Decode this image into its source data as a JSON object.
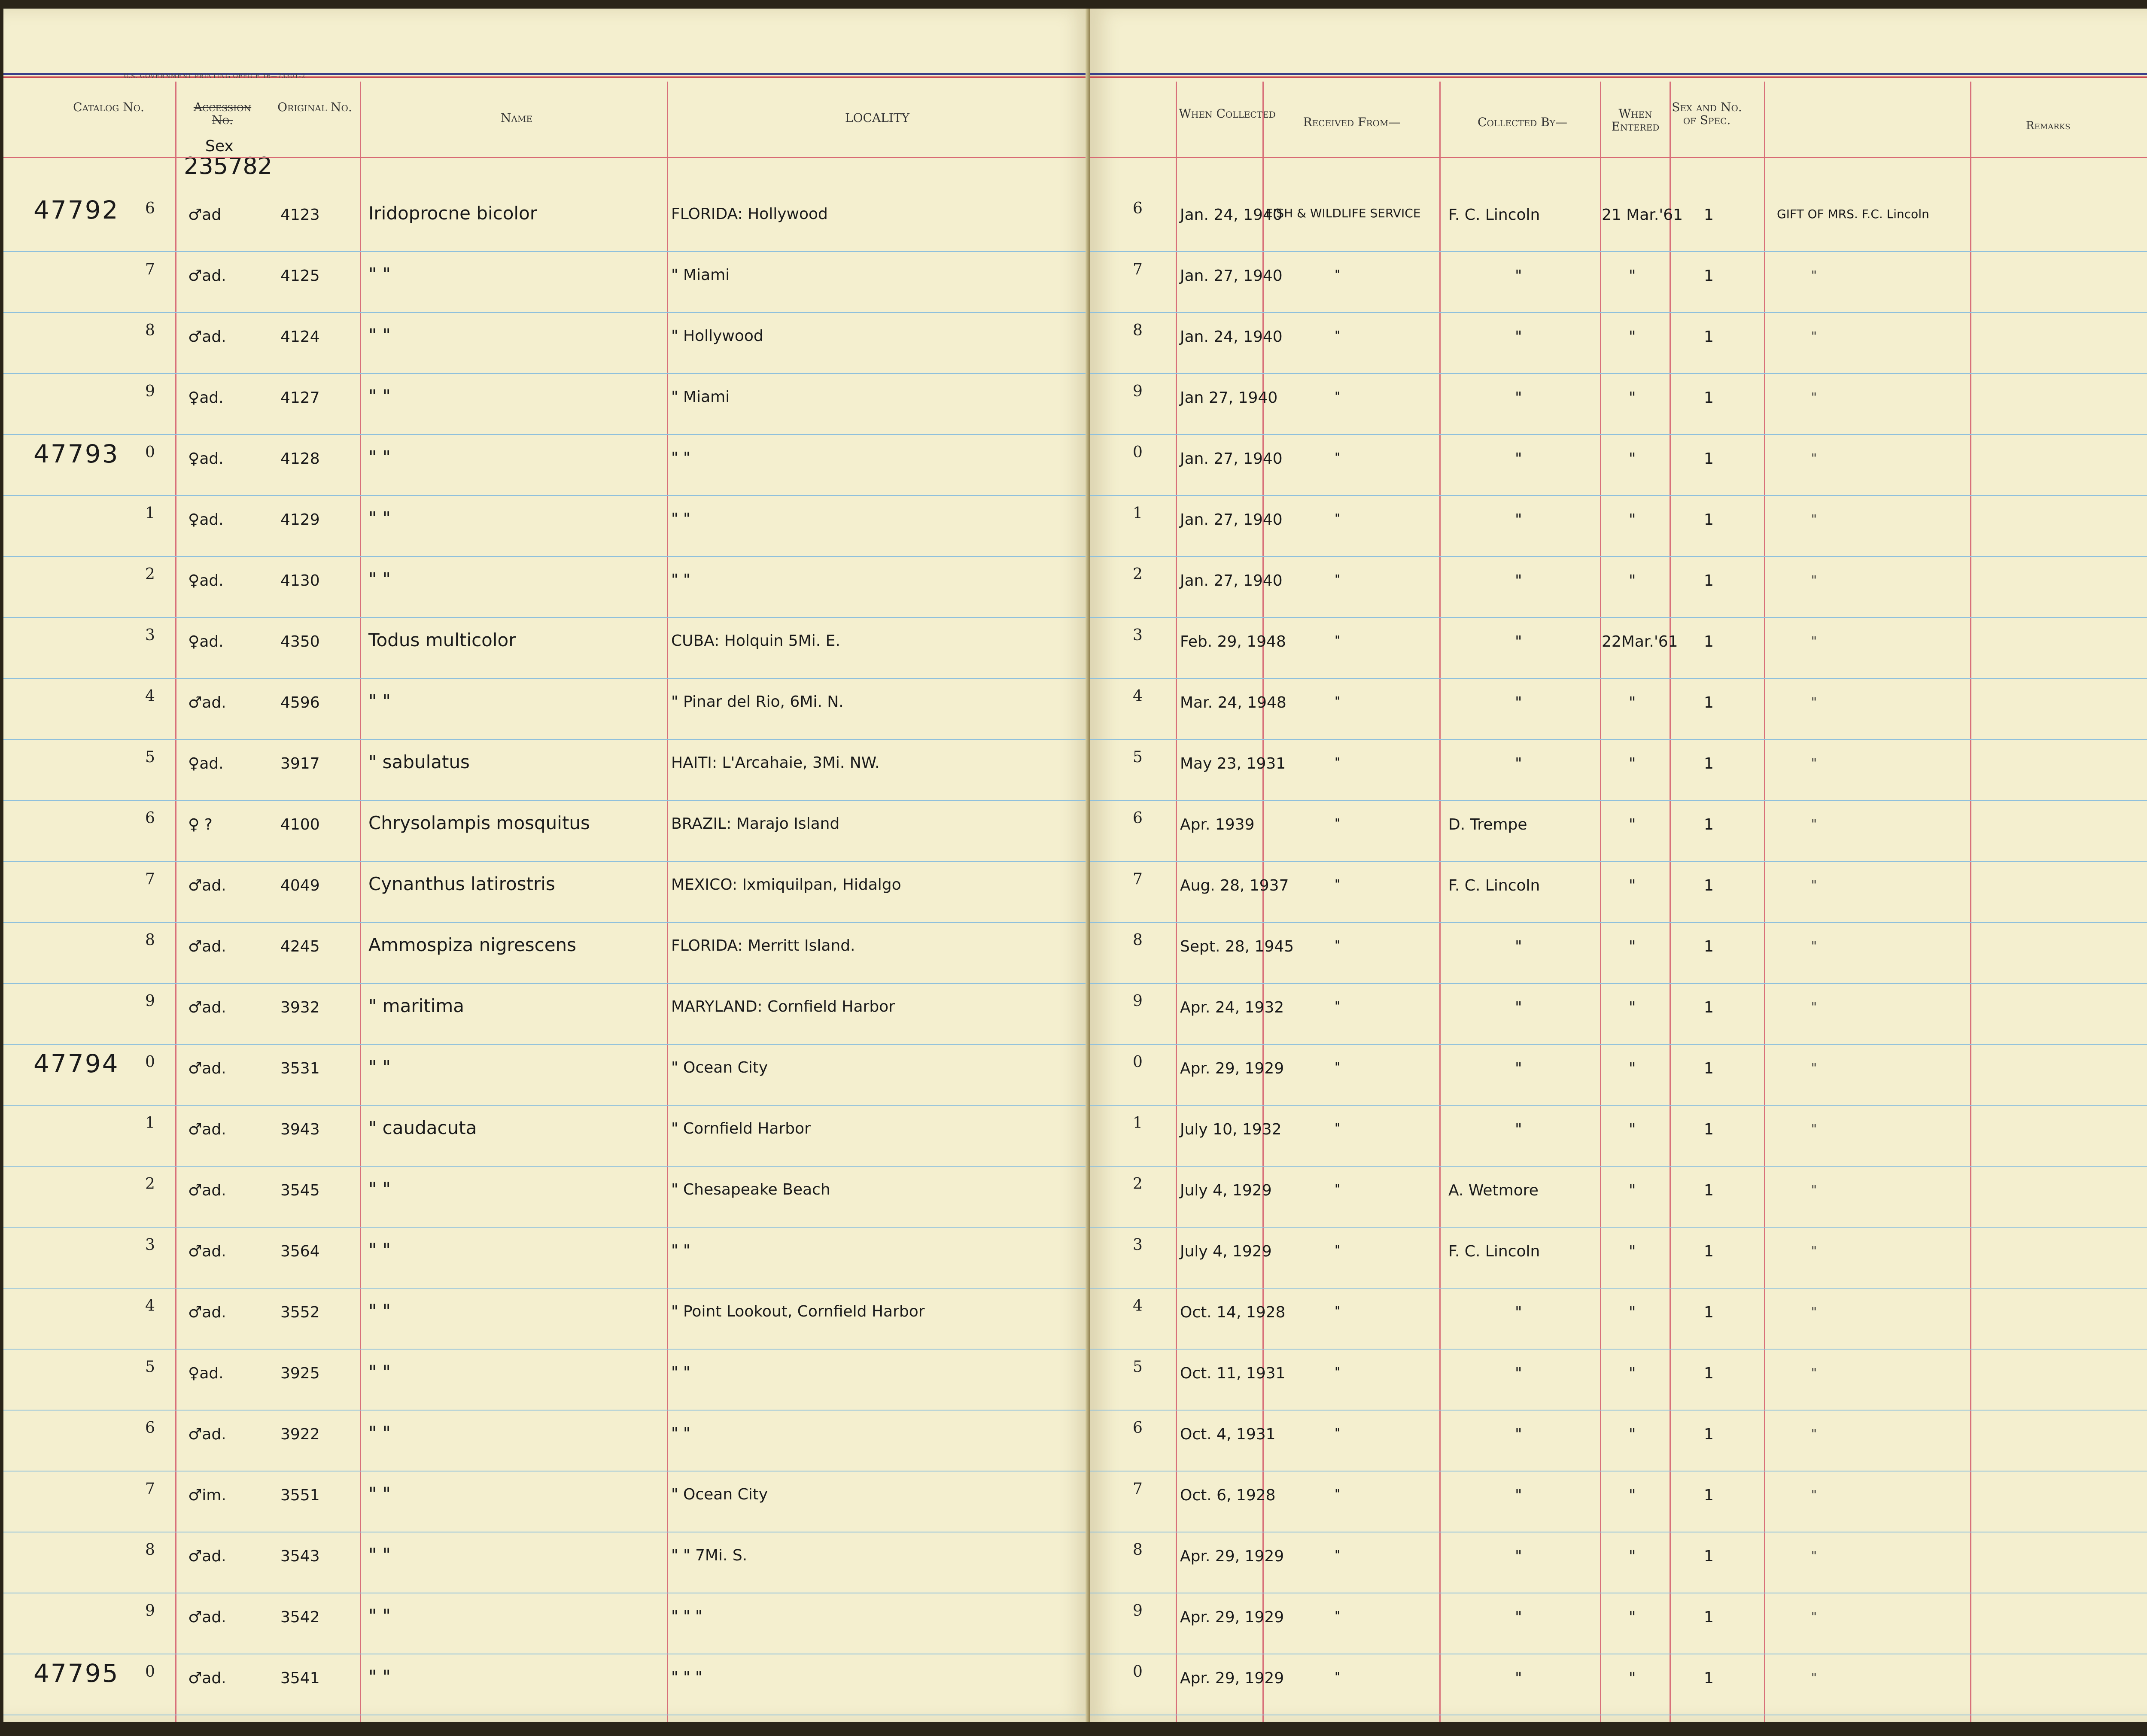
{
  "header_print": {
    "gpo": "U.S. GOVERNMENT PRINTING OFFICE     16—73301-2"
  },
  "columns_left": {
    "catalog": "Catalog No.",
    "accession": "Accession No.",
    "sex_handwritten": "Sex",
    "original": "Original No.",
    "name": "Name",
    "locality": "LOCALITY"
  },
  "columns_right": {
    "when_collected": "When Collected",
    "received_from": "Received From—",
    "collected_by": "Collected By—",
    "when_entered": "When Entered",
    "sex_no_spec": "Sex and No. of Spec.",
    "remarks": "Remarks"
  },
  "accession_number": "235782",
  "rows": [
    {
      "cat": "47792",
      "d": "6",
      "sex": "♂ad",
      "orig": "4123",
      "name": "Iridoprocne bicolor",
      "loc": "FLORIDA: Hollywood",
      "date": "Jan. 24, 1940",
      "recv": "FISH & WILDLIFE SERVICE",
      "coll": "F. C. Lincoln",
      "ent": "21 Mar.'61",
      "spec": "1",
      "rem": "GIFT OF MRS. F.C. Lincoln"
    },
    {
      "cat": "",
      "d": "7",
      "sex": "♂ad.",
      "orig": "4125",
      "name": "\"     \"",
      "loc": "\"     Miami",
      "date": "Jan. 27, 1940",
      "recv": "\"",
      "coll": "\"",
      "ent": "\"",
      "spec": "1",
      "rem": "\""
    },
    {
      "cat": "",
      "d": "8",
      "sex": "♂ad.",
      "orig": "4124",
      "name": "\"     \"",
      "loc": "\"     Hollywood",
      "date": "Jan. 24, 1940",
      "recv": "\"",
      "coll": "\"",
      "ent": "\"",
      "spec": "1",
      "rem": "\""
    },
    {
      "cat": "",
      "d": "9",
      "sex": "♀ad.",
      "orig": "4127",
      "name": "\"     \"",
      "loc": "\"     Miami",
      "date": "Jan 27, 1940",
      "recv": "\"",
      "coll": "\"",
      "ent": "\"",
      "spec": "1",
      "rem": "\""
    },
    {
      "cat": "47793",
      "d": "0",
      "sex": "♀ad.",
      "orig": "4128",
      "name": "\"     \"",
      "loc": "\"     \"",
      "date": "Jan. 27, 1940",
      "recv": "\"",
      "coll": "\"",
      "ent": "\"",
      "spec": "1",
      "rem": "\""
    },
    {
      "cat": "",
      "d": "1",
      "sex": "♀ad.",
      "orig": "4129",
      "name": "\"     \"",
      "loc": "\"     \"",
      "date": "Jan. 27, 1940",
      "recv": "\"",
      "coll": "\"",
      "ent": "\"",
      "spec": "1",
      "rem": "\""
    },
    {
      "cat": "",
      "d": "2",
      "sex": "♀ad.",
      "orig": "4130",
      "name": "\"     \"",
      "loc": "\"     \"",
      "date": "Jan. 27, 1940",
      "recv": "\"",
      "coll": "\"",
      "ent": "\"",
      "spec": "1",
      "rem": "\""
    },
    {
      "cat": "",
      "d": "3",
      "sex": "♀ad.",
      "orig": "4350",
      "name": "Todus multicolor",
      "loc": "CUBA: Holquin 5Mi. E.",
      "date": "Feb. 29, 1948",
      "recv": "\"",
      "coll": "\"",
      "ent": "22Mar.'61",
      "spec": "1",
      "rem": "\""
    },
    {
      "cat": "",
      "d": "4",
      "sex": "♂ad.",
      "orig": "4596",
      "name": "\"     \"",
      "loc": "\"     Pinar del Rio, 6Mi. N.",
      "date": "Mar. 24, 1948",
      "recv": "\"",
      "coll": "\"",
      "ent": "\"",
      "spec": "1",
      "rem": "\""
    },
    {
      "cat": "",
      "d": "5",
      "sex": "♀ad.",
      "orig": "3917",
      "name": "\"     sabulatus",
      "loc": "HAITI: L'Arcahaie, 3Mi. NW.",
      "date": "May 23, 1931",
      "recv": "\"",
      "coll": "\"",
      "ent": "\"",
      "spec": "1",
      "rem": "\""
    },
    {
      "cat": "",
      "d": "6",
      "sex": "♀ ?",
      "orig": "4100",
      "name": "Chrysolampis mosquitus",
      "loc": "BRAZIL: Marajo Island",
      "date": "Apr. 1939",
      "recv": "\"",
      "coll": "D. Trempe",
      "ent": "\"",
      "spec": "1",
      "rem": "\""
    },
    {
      "cat": "",
      "d": "7",
      "sex": "♂ad.",
      "orig": "4049",
      "name": "Cynanthus latirostris",
      "loc": "MEXICO: Ixmiquilpan, Hidalgo",
      "date": "Aug. 28, 1937",
      "recv": "\"",
      "coll": "F. C. Lincoln",
      "ent": "\"",
      "spec": "1",
      "rem": "\""
    },
    {
      "cat": "",
      "d": "8",
      "sex": "♂ad.",
      "orig": "4245",
      "name": "Ammospiza nigrescens",
      "loc": "FLORIDA: Merritt Island.",
      "date": "Sept. 28, 1945",
      "recv": "\"",
      "coll": "\"",
      "ent": "\"",
      "spec": "1",
      "rem": "\""
    },
    {
      "cat": "",
      "d": "9",
      "sex": "♂ad.",
      "orig": "3932",
      "name": "\"     maritima",
      "loc": "MARYLAND: Cornfield Harbor",
      "date": "Apr. 24, 1932",
      "recv": "\"",
      "coll": "\"",
      "ent": "\"",
      "spec": "1",
      "rem": "\""
    },
    {
      "cat": "47794",
      "d": "0",
      "sex": "♂ad.",
      "orig": "3531",
      "name": "\"     \"",
      "loc": "\"     Ocean City",
      "date": "Apr. 29, 1929",
      "recv": "\"",
      "coll": "\"",
      "ent": "\"",
      "spec": "1",
      "rem": "\""
    },
    {
      "cat": "",
      "d": "1",
      "sex": "♂ad.",
      "orig": "3943",
      "name": "\"     caudacuta",
      "loc": "\"     Cornfield Harbor",
      "date": "July 10, 1932",
      "recv": "\"",
      "coll": "\"",
      "ent": "\"",
      "spec": "1",
      "rem": "\""
    },
    {
      "cat": "",
      "d": "2",
      "sex": "♂ad.",
      "orig": "3545",
      "name": "\"     \"",
      "loc": "\"     Chesapeake Beach",
      "date": "July 4, 1929",
      "recv": "\"",
      "coll": "A. Wetmore",
      "ent": "\"",
      "spec": "1",
      "rem": "\""
    },
    {
      "cat": "",
      "d": "3",
      "sex": "♂ad.",
      "orig": "3564",
      "name": "\"     \"",
      "loc": "\"     \"",
      "date": "July 4, 1929",
      "recv": "\"",
      "coll": "F. C. Lincoln",
      "ent": "\"",
      "spec": "1",
      "rem": "\""
    },
    {
      "cat": "",
      "d": "4",
      "sex": "♂ad.",
      "orig": "3552",
      "name": "\"     \"",
      "loc": "\"     Point Lookout, Cornfield Harbor",
      "date": "Oct. 14, 1928",
      "recv": "\"",
      "coll": "\"",
      "ent": "\"",
      "spec": "1",
      "rem": "\""
    },
    {
      "cat": "",
      "d": "5",
      "sex": "♀ad.",
      "orig": "3925",
      "name": "\"     \"",
      "loc": "\"     \"",
      "date": "Oct. 11, 1931",
      "recv": "\"",
      "coll": "\"",
      "ent": "\"",
      "spec": "1",
      "rem": "\""
    },
    {
      "cat": "",
      "d": "6",
      "sex": "♂ad.",
      "orig": "3922",
      "name": "\"     \"",
      "loc": "\"     \"",
      "date": "Oct. 4, 1931",
      "recv": "\"",
      "coll": "\"",
      "ent": "\"",
      "spec": "1",
      "rem": "\""
    },
    {
      "cat": "",
      "d": "7",
      "sex": "♂im.",
      "orig": "3551",
      "name": "\"     \"",
      "loc": "\"     Ocean City",
      "date": "Oct. 6, 1928",
      "recv": "\"",
      "coll": "\"",
      "ent": "\"",
      "spec": "1",
      "rem": "\""
    },
    {
      "cat": "",
      "d": "8",
      "sex": "♂ad.",
      "orig": "3543",
      "name": "\"     \"",
      "loc": "\"     \"     7Mi. S.",
      "date": "Apr. 29, 1929",
      "recv": "\"",
      "coll": "\"",
      "ent": "\"",
      "spec": "1",
      "rem": "\""
    },
    {
      "cat": "",
      "d": "9",
      "sex": "♂ad.",
      "orig": "3542",
      "name": "\"     \"",
      "loc": "\"     \"     \"",
      "date": "Apr. 29, 1929",
      "recv": "\"",
      "coll": "\"",
      "ent": "\"",
      "spec": "1",
      "rem": "\""
    },
    {
      "cat": "47795",
      "d": "0",
      "sex": "♂ad.",
      "orig": "3541",
      "name": "\"     \"",
      "loc": "\"     \"     \"",
      "date": "Apr. 29, 1929",
      "recv": "\"",
      "coll": "\"",
      "ent": "\"",
      "spec": "1",
      "rem": "\""
    }
  ]
}
